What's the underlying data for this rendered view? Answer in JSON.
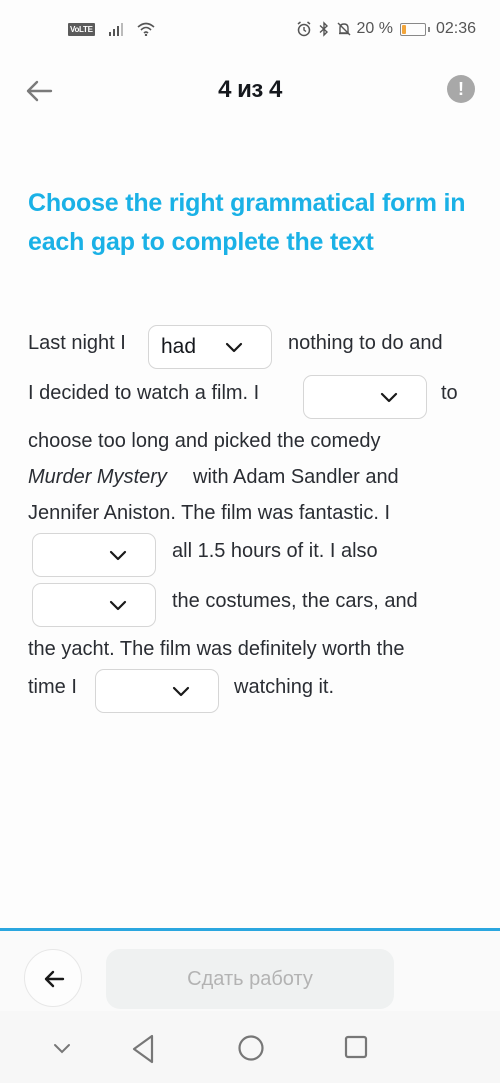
{
  "status_bar": {
    "network_badge": "VoLTE",
    "battery_percent_text": "20 %",
    "battery_level": 0.2,
    "time": "02:36",
    "icons": [
      "volte-icon",
      "signal-icon",
      "wifi-icon",
      "alarm-icon",
      "bluetooth-icon",
      "bell-off-icon",
      "battery-icon"
    ]
  },
  "header": {
    "title": "4 из 4",
    "back_icon": "arrow-left-icon",
    "info_icon": "exclamation-icon",
    "info_glyph": "!"
  },
  "task": {
    "title": "Choose the right grammatical form in each gap to complete the text"
  },
  "passage": {
    "segments": [
      "Last night I",
      "nothing to do and",
      "I decided to watch a film. I",
      "to",
      "choose too long and picked the comedy",
      "Murder Mystery",
      "with Adam Sandler and",
      "Jennifer Aniston. The film was fantastic. I",
      "all 1.5 hours of it. I also",
      "the costumes, the cars, and",
      "the yacht. The film was definitely worth the",
      "time I",
      "watching it."
    ],
    "gaps": [
      {
        "value": "",
        "selected": "had"
      },
      {
        "value": "",
        "selected": ""
      },
      {
        "value": "",
        "selected": ""
      },
      {
        "value": "",
        "selected": ""
      },
      {
        "value": "",
        "selected": ""
      }
    ]
  },
  "bottom_bar": {
    "back_icon": "arrow-left-icon",
    "submit_label": "Сдать работу"
  },
  "navigation_bar": {
    "buttons": [
      "chevron-down-icon",
      "back-triangle-icon",
      "home-circle-icon",
      "recents-square-icon"
    ]
  },
  "colors": {
    "accent": "#1ab1e6",
    "divider": "#2aa6df",
    "battery_fill": "#f2a53b",
    "submit_disabled_bg": "#eff1f1",
    "submit_disabled_text": "#b3b3b3"
  }
}
